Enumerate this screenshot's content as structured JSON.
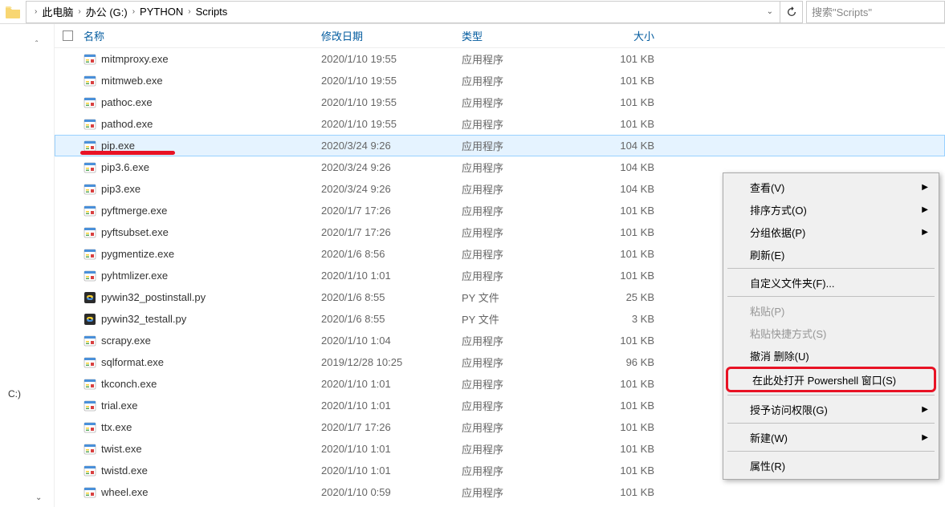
{
  "breadcrumb": {
    "items": [
      "此电脑",
      "办公 (G:)",
      "PYTHON",
      "Scripts"
    ]
  },
  "search": {
    "placeholder": "搜索\"Scripts\""
  },
  "sidebar": {
    "drive_label": "C:)"
  },
  "columns": {
    "name": "名称",
    "date": "修改日期",
    "type": "类型",
    "size": "大小"
  },
  "files": [
    {
      "name": "mitmproxy.exe",
      "date": "2020/1/10 19:55",
      "type": "应用程序",
      "size": "101 KB",
      "icon": "exe"
    },
    {
      "name": "mitmweb.exe",
      "date": "2020/1/10 19:55",
      "type": "应用程序",
      "size": "101 KB",
      "icon": "exe"
    },
    {
      "name": "pathoc.exe",
      "date": "2020/1/10 19:55",
      "type": "应用程序",
      "size": "101 KB",
      "icon": "exe"
    },
    {
      "name": "pathod.exe",
      "date": "2020/1/10 19:55",
      "type": "应用程序",
      "size": "101 KB",
      "icon": "exe"
    },
    {
      "name": "pip.exe",
      "date": "2020/3/24 9:26",
      "type": "应用程序",
      "size": "104 KB",
      "icon": "exe",
      "highlighted": true,
      "red_underline": true
    },
    {
      "name": "pip3.6.exe",
      "date": "2020/3/24 9:26",
      "type": "应用程序",
      "size": "104 KB",
      "icon": "exe"
    },
    {
      "name": "pip3.exe",
      "date": "2020/3/24 9:26",
      "type": "应用程序",
      "size": "104 KB",
      "icon": "exe"
    },
    {
      "name": "pyftmerge.exe",
      "date": "2020/1/7 17:26",
      "type": "应用程序",
      "size": "101 KB",
      "icon": "exe"
    },
    {
      "name": "pyftsubset.exe",
      "date": "2020/1/7 17:26",
      "type": "应用程序",
      "size": "101 KB",
      "icon": "exe"
    },
    {
      "name": "pygmentize.exe",
      "date": "2020/1/6 8:56",
      "type": "应用程序",
      "size": "101 KB",
      "icon": "exe"
    },
    {
      "name": "pyhtmlizer.exe",
      "date": "2020/1/10 1:01",
      "type": "应用程序",
      "size": "101 KB",
      "icon": "exe"
    },
    {
      "name": "pywin32_postinstall.py",
      "date": "2020/1/6 8:55",
      "type": "PY 文件",
      "size": "25 KB",
      "icon": "py"
    },
    {
      "name": "pywin32_testall.py",
      "date": "2020/1/6 8:55",
      "type": "PY 文件",
      "size": "3 KB",
      "icon": "py"
    },
    {
      "name": "scrapy.exe",
      "date": "2020/1/10 1:04",
      "type": "应用程序",
      "size": "101 KB",
      "icon": "exe"
    },
    {
      "name": "sqlformat.exe",
      "date": "2019/12/28 10:25",
      "type": "应用程序",
      "size": "96 KB",
      "icon": "exe"
    },
    {
      "name": "tkconch.exe",
      "date": "2020/1/10 1:01",
      "type": "应用程序",
      "size": "101 KB",
      "icon": "exe"
    },
    {
      "name": "trial.exe",
      "date": "2020/1/10 1:01",
      "type": "应用程序",
      "size": "101 KB",
      "icon": "exe"
    },
    {
      "name": "ttx.exe",
      "date": "2020/1/7 17:26",
      "type": "应用程序",
      "size": "101 KB",
      "icon": "exe"
    },
    {
      "name": "twist.exe",
      "date": "2020/1/10 1:01",
      "type": "应用程序",
      "size": "101 KB",
      "icon": "exe"
    },
    {
      "name": "twistd.exe",
      "date": "2020/1/10 1:01",
      "type": "应用程序",
      "size": "101 KB",
      "icon": "exe"
    },
    {
      "name": "wheel.exe",
      "date": "2020/1/10 0:59",
      "type": "应用程序",
      "size": "101 KB",
      "icon": "exe"
    }
  ],
  "context_menu": {
    "view": "查看(V)",
    "sort": "排序方式(O)",
    "group": "分组依据(P)",
    "refresh": "刷新(E)",
    "customize": "自定义文件夹(F)...",
    "paste": "粘贴(P)",
    "paste_shortcut": "粘贴快捷方式(S)",
    "undo_delete": "撤消 删除(U)",
    "powershell": "在此处打开 Powershell 窗口(S)",
    "access": "授予访问权限(G)",
    "new": "新建(W)",
    "properties": "属性(R)"
  }
}
